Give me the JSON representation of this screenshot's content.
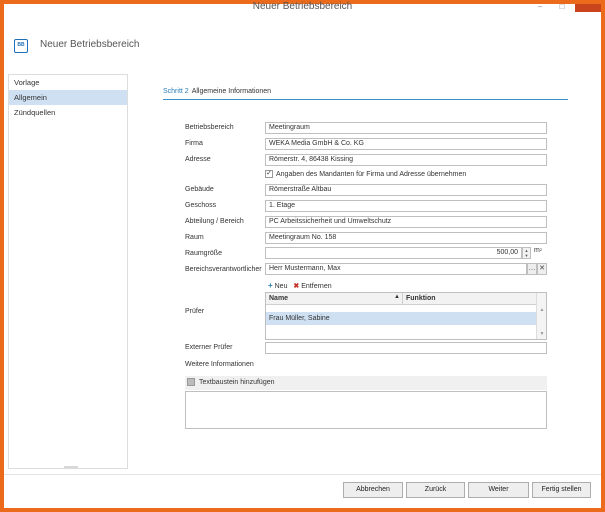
{
  "window": {
    "title": "Neuer Betriebsbereich",
    "close_glyph": "x",
    "max_glyph": "□",
    "min_glyph": "–"
  },
  "header": {
    "title": "Neuer Betriebsbereich",
    "icon_text": "BB",
    "icon": "building-icon"
  },
  "sidebar": {
    "items": [
      {
        "label": "Vorlage"
      },
      {
        "label": "Allgemein",
        "active": true
      },
      {
        "label": "Zündquellen"
      }
    ]
  },
  "step": {
    "number": "Schritt 2",
    "name": "Allgemeine Informationen"
  },
  "form": {
    "betriebsbereich": {
      "label": "Betriebsbereich",
      "value": "Meetingraum"
    },
    "firma": {
      "label": "Firma",
      "value": "WEKA Media GmbH & Co. KG"
    },
    "adresse": {
      "label": "Adresse",
      "value": "Römerstr. 4, 86438 Kissing"
    },
    "checkbox": {
      "label": "Angaben des Mandanten für Firma und Adresse übernehmen",
      "checked": true,
      "mark": "✓"
    },
    "gebaeude": {
      "label": "Gebäude",
      "value": "Römerstraße Altbau"
    },
    "geschoss": {
      "label": "Geschoss",
      "value": "1. Etage"
    },
    "abteilung": {
      "label": "Abteilung / Bereich",
      "value": "PC Arbeitssicherheit und Umweltschutz"
    },
    "raum": {
      "label": "Raum",
      "value": "Meetingraum No. 158"
    },
    "raumgroesse": {
      "label": "Raumgröße",
      "value": "500,00",
      "unit": "m",
      "unit_sup": "2",
      "spin_up": "▲",
      "spin_down": "▼"
    },
    "bereichsverantwortlicher": {
      "label": "Bereichsverantwortlicher",
      "value": "Herr Mustermann, Max",
      "dots": "…",
      "clear": "✕"
    },
    "pruefer": {
      "label": "Prüfer",
      "toolbar": {
        "new_icon": "+",
        "new_label": "Neu",
        "remove_icon": "✖",
        "remove_label": "Entfernen"
      },
      "columns": {
        "name": "Name",
        "sort": "▲",
        "function": "Funktion"
      },
      "rows": [
        {
          "name": "Frau Müller, Sabine",
          "function": ""
        }
      ],
      "scroll_up": "▲",
      "scroll_down": "▼"
    },
    "externer_pruefer": {
      "label": "Externer Prüfer",
      "value": ""
    }
  },
  "weitere": {
    "title": "Weitere Informationen",
    "textbaustein_label": "Textbaustein hinzufügen",
    "text": ""
  },
  "footer": {
    "abbrechen": "Abbrechen",
    "zurueck": "Zurück",
    "weiter": "Weiter",
    "fertig": "Fertig stellen"
  },
  "colors": {
    "accent": "#2a7fb8",
    "frame": "#ec6a1c",
    "selection": "#cfe0f2"
  }
}
